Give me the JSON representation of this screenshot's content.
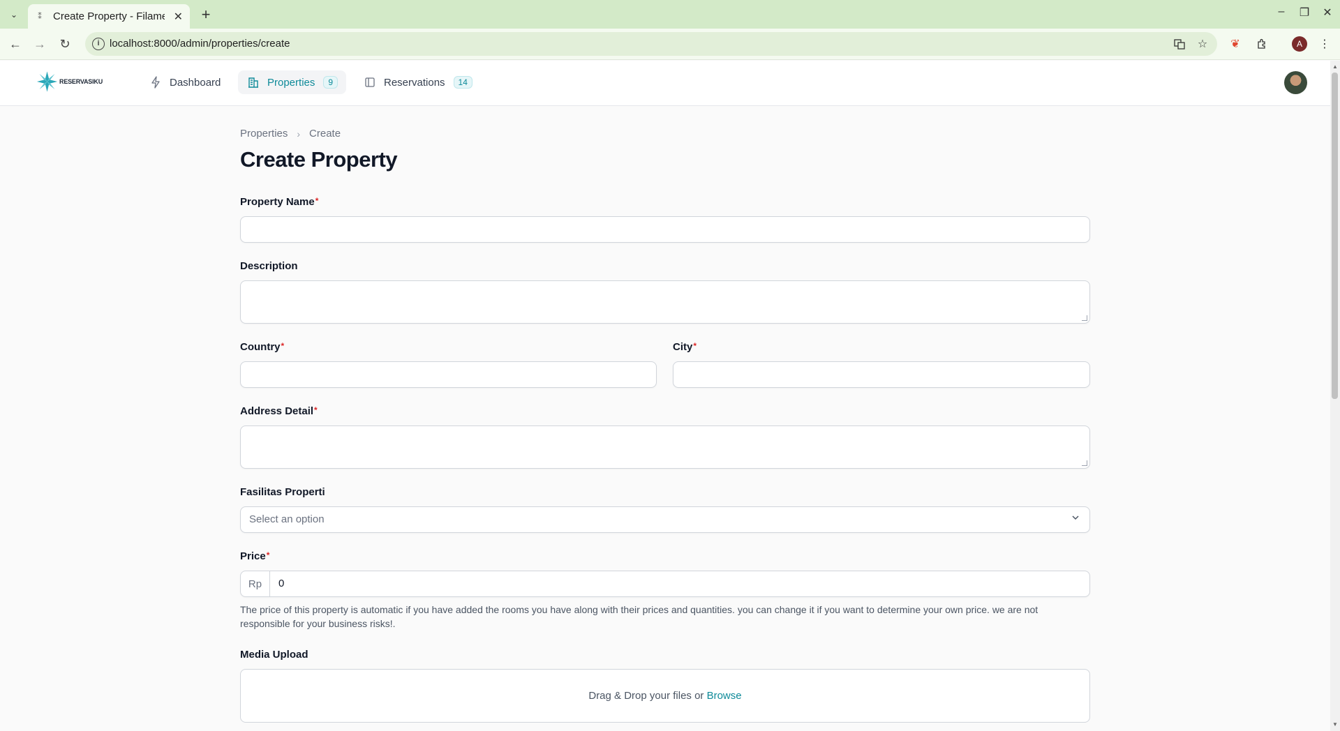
{
  "browser": {
    "tab_title": "Create Property - Filame",
    "url": "localhost:8000/admin/properties/create",
    "profile_initial": "A"
  },
  "app": {
    "logo_text": "RESERVASIKU",
    "nav": [
      {
        "label": "Dashboard",
        "icon": "bolt-icon"
      },
      {
        "label": "Properties",
        "count": "9",
        "icon": "building-icon"
      },
      {
        "label": "Reservations",
        "count": "14",
        "icon": "book-icon"
      }
    ],
    "accent_color": "#0e8a99"
  },
  "breadcrumb": {
    "parent": "Properties",
    "current": "Create"
  },
  "page": {
    "title": "Create Property"
  },
  "form": {
    "property_name_label": "Property Name",
    "description_label": "Description",
    "country_label": "Country",
    "city_label": "City",
    "address_label": "Address Detail",
    "facilities_label": "Fasilitas Properti",
    "facilities_placeholder": "Select an option",
    "price_label": "Price",
    "price_prefix": "Rp",
    "price_value": "0",
    "price_help": "The price of this property is automatic if you have added the rooms you have along with their prices and quantities. you can change it if you want to determine your own price. we are not responsible for your business risks!.",
    "media_label": "Media Upload",
    "dropzone_text": "Drag & Drop your files or",
    "dropzone_link": "Browse",
    "required_mark": "*"
  }
}
